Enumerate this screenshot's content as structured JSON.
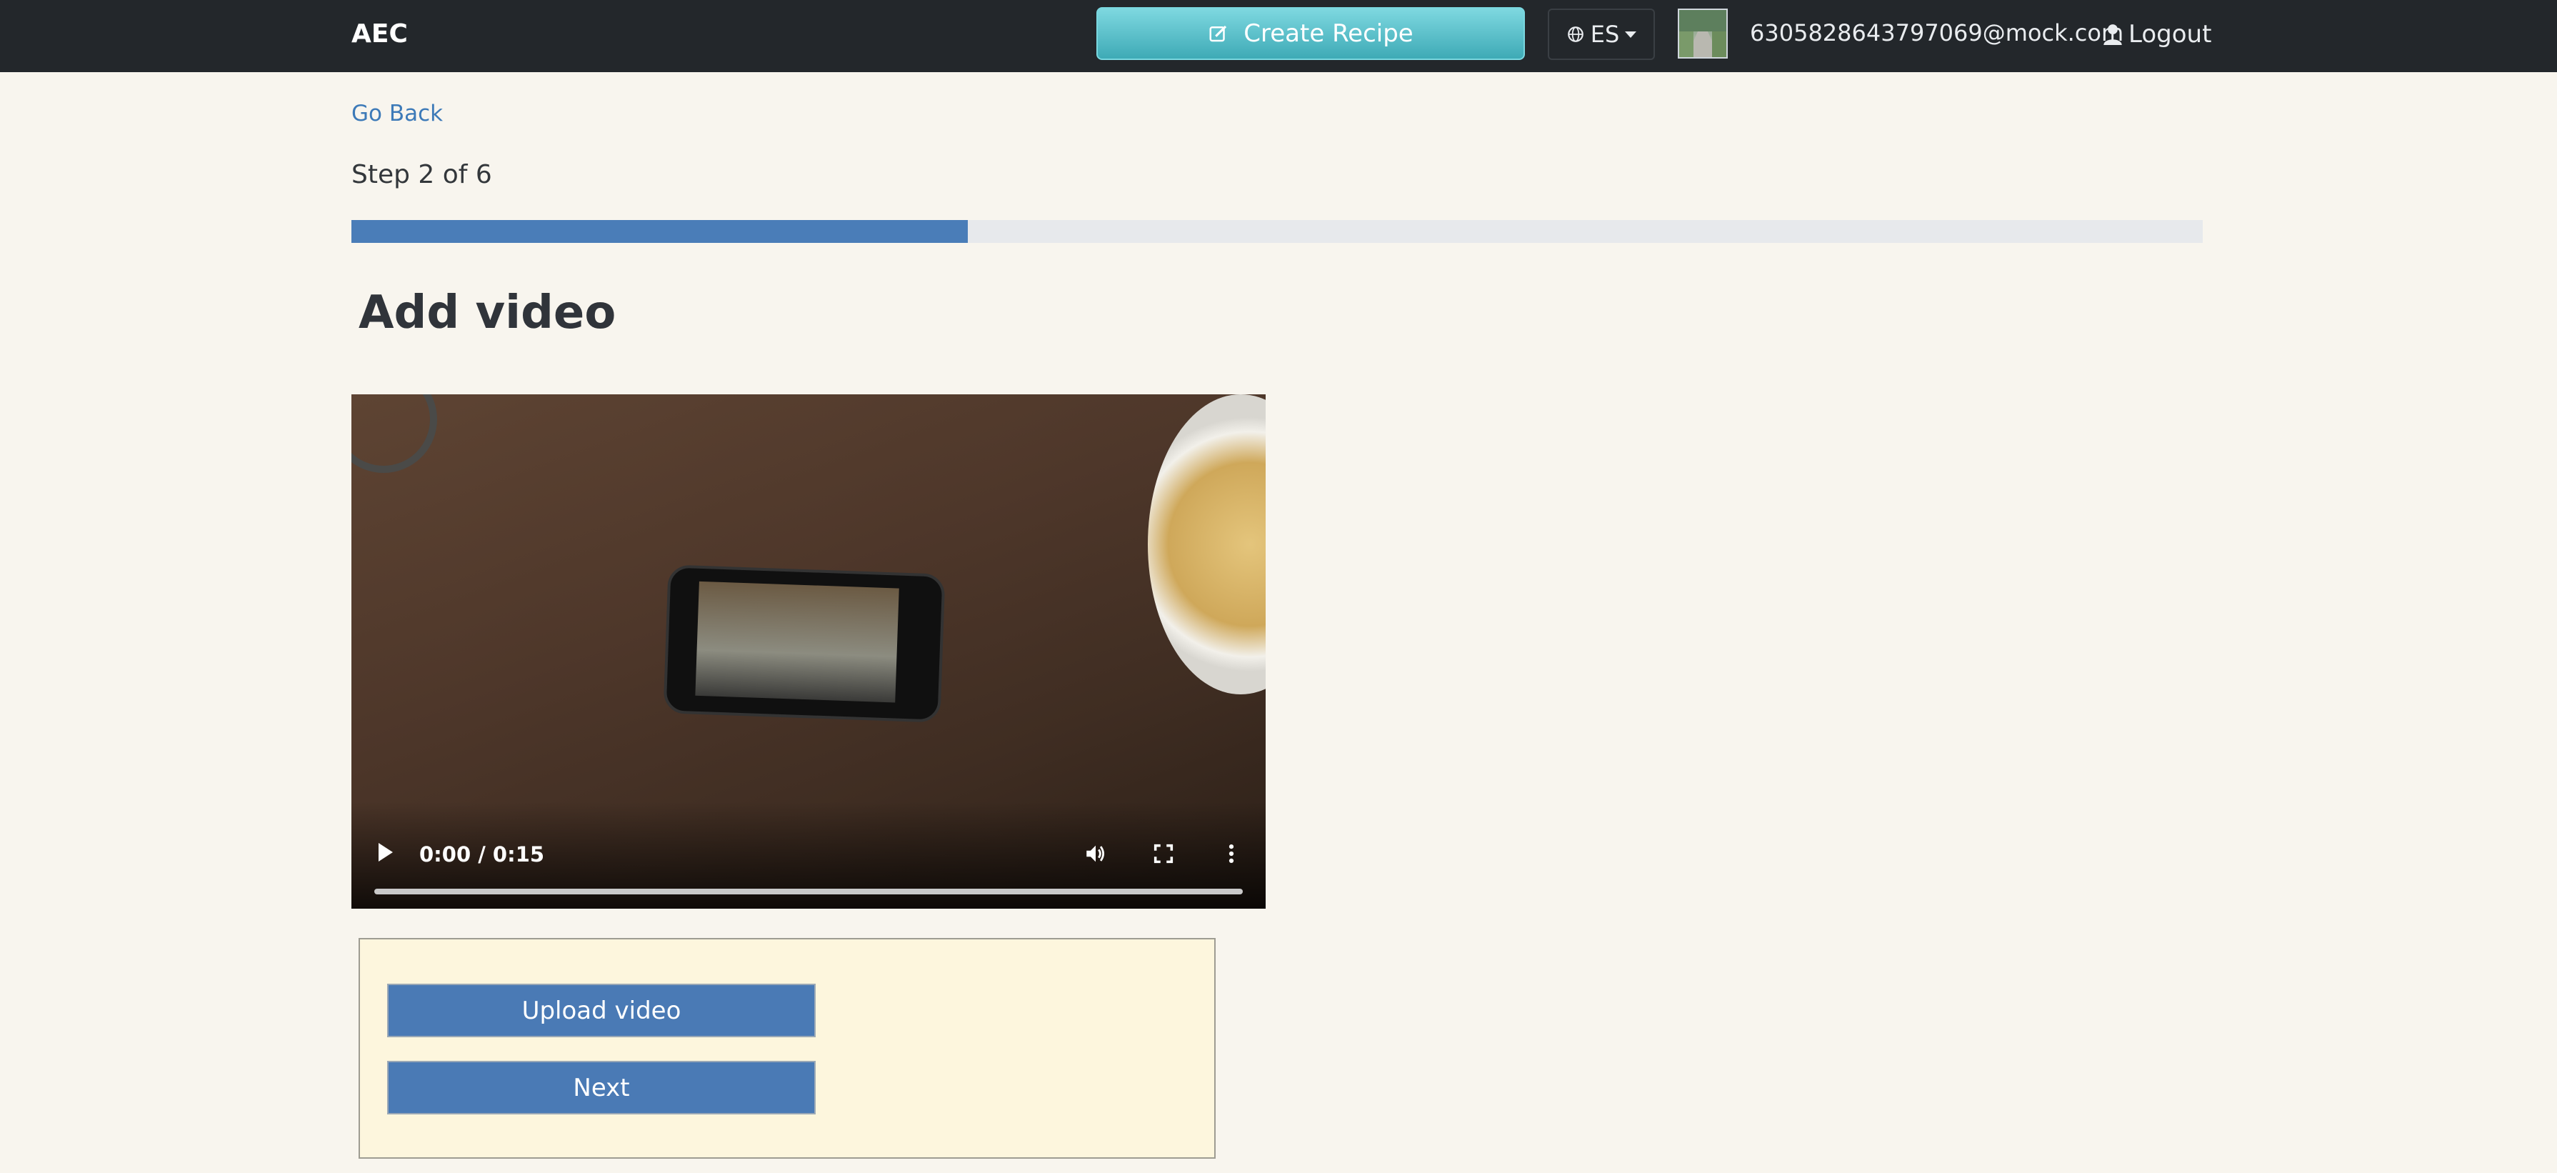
{
  "header": {
    "brand": "AEC",
    "create_recipe_label": "Create Recipe",
    "language_label": "ES",
    "user_email": "6305828643797069@mock.com",
    "logout_label": "Logout"
  },
  "nav": {
    "go_back_label": "Go Back"
  },
  "wizard": {
    "step_text": "Step 2 of 6",
    "progress_fraction": 0.333,
    "heading": "Add video"
  },
  "video": {
    "time_display": "0:00 / 0:15"
  },
  "actions": {
    "upload_label": "Upload video",
    "next_label": "Next"
  },
  "colors": {
    "topbar": "#23272b",
    "primary": "#4a7ab5",
    "accent": "#3eaab6",
    "page_bg": "#f8f5ee",
    "panel_bg": "#fdf6dd"
  }
}
